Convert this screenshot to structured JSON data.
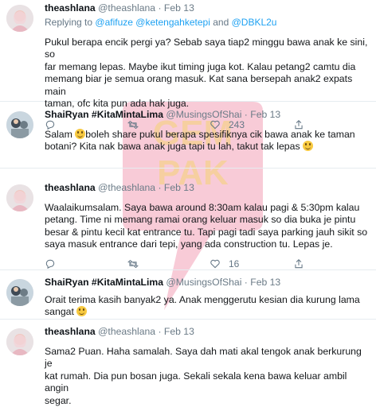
{
  "tweets": [
    {
      "name": "theashlana",
      "handle": "@theashlana",
      "date": "Feb 13",
      "replying_to": {
        "prefix": "Replying to",
        "mention1": "@afifuze",
        "mention2": "@ketengahketepi",
        "conj": "and",
        "mention3": "@DBKL2u"
      },
      "lines": [
        "Pukul berapa encik pergi ya? Sebab saya tiap2 minggu bawa anak ke sini, so",
        "far memang lepas. Maybe ikut timing juga kot. Kalau petang2 camtu dia",
        "memang biar je semua orang masuk. Kat sana bersepah anak2 expats main",
        "taman, ofc kita pun ada hak juga."
      ],
      "retweets": "",
      "likes": "243"
    },
    {
      "name": "ShaiRyan #KitaMintaLima",
      "handle": "@MusingsOfShai",
      "date": "Feb 13",
      "line1_a": "Salam",
      "line1_b": "boleh share pukul berapa spesifiknya cik bawa anak ke taman",
      "line2": "botani? Kita nak bawa anak juga tapi tu lah, takut tak lepas"
    },
    {
      "name": "theashlana",
      "handle": "@theashlana",
      "date": "Feb 13",
      "lines": [
        "Waalaikumsalam. Saya bawa around 8:30am kalau pagi & 5:30pm kalau",
        "petang. Time ni memang ramai orang keluar masuk so dia buka je pintu",
        "besar & pintu kecil kat entrance tu. Tapi pagi tadi saya parking jauh sikit so",
        "saya masuk entrance dari tepi, yang ada construction tu. Lepas je."
      ],
      "likes": "16"
    },
    {
      "name": "ShaiRyan #KitaMintaLima",
      "handle": "@MusingsOfShai",
      "date": "Feb 13",
      "line1": "Orait terima kasih banyak2 ya. Anak menggerutu kesian dia kurung lama",
      "line2": "sangat"
    },
    {
      "name": "theashlana",
      "handle": "@theashlana",
      "date": "Feb 13",
      "lines": [
        "Sama2 Puan. Haha samalah. Saya dah mati akal tengok anak berkurung je",
        "kat rumah. Dia pun bosan juga. Sekali sekala kena bawa keluar ambil angin",
        "segar."
      ]
    }
  ],
  "watermark": {
    "line1": "GEM",
    "line2": "PAK",
    "color": "#f3a0b6"
  },
  "colors": {
    "accent": "#1da1f2",
    "muted": "#657786",
    "divider": "#e6ecf0"
  }
}
